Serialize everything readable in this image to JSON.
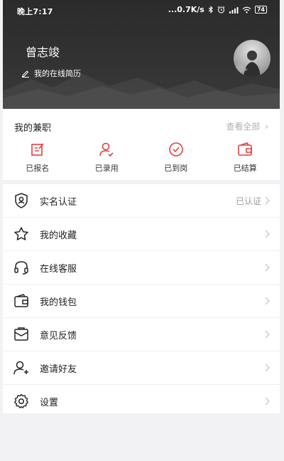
{
  "status": {
    "time": "晚上7:17",
    "network_speed": "...0.7K/s",
    "battery": "74"
  },
  "profile": {
    "name": "曾志竣",
    "resume_link": "我的在线简历"
  },
  "parttime": {
    "title": "我的兼职",
    "view_all": "查看全部",
    "items": [
      {
        "label": "已报名",
        "icon": "edit-form-icon"
      },
      {
        "label": "已录用",
        "icon": "user-check-icon"
      },
      {
        "label": "已到岗",
        "icon": "check-circle-icon"
      },
      {
        "label": "已结算",
        "icon": "wallet-icon"
      }
    ]
  },
  "menu": [
    {
      "label": "实名认证",
      "value": "已认证",
      "icon": "id-verify-icon"
    },
    {
      "label": "我的收藏",
      "value": "",
      "icon": "star-icon"
    },
    {
      "label": "在线客服",
      "value": "",
      "icon": "headset-icon"
    },
    {
      "label": "我的钱包",
      "value": "",
      "icon": "wallet-icon"
    },
    {
      "label": "意见反馈",
      "value": "",
      "icon": "feedback-mail-icon"
    },
    {
      "label": "邀请好友",
      "value": "",
      "icon": "add-user-icon"
    },
    {
      "label": "设置",
      "value": "",
      "icon": "gear-icon"
    }
  ],
  "colors": {
    "accent": "#e04040",
    "header_bg": "#2f2f2f",
    "page_bg": "#f2f2f4"
  }
}
